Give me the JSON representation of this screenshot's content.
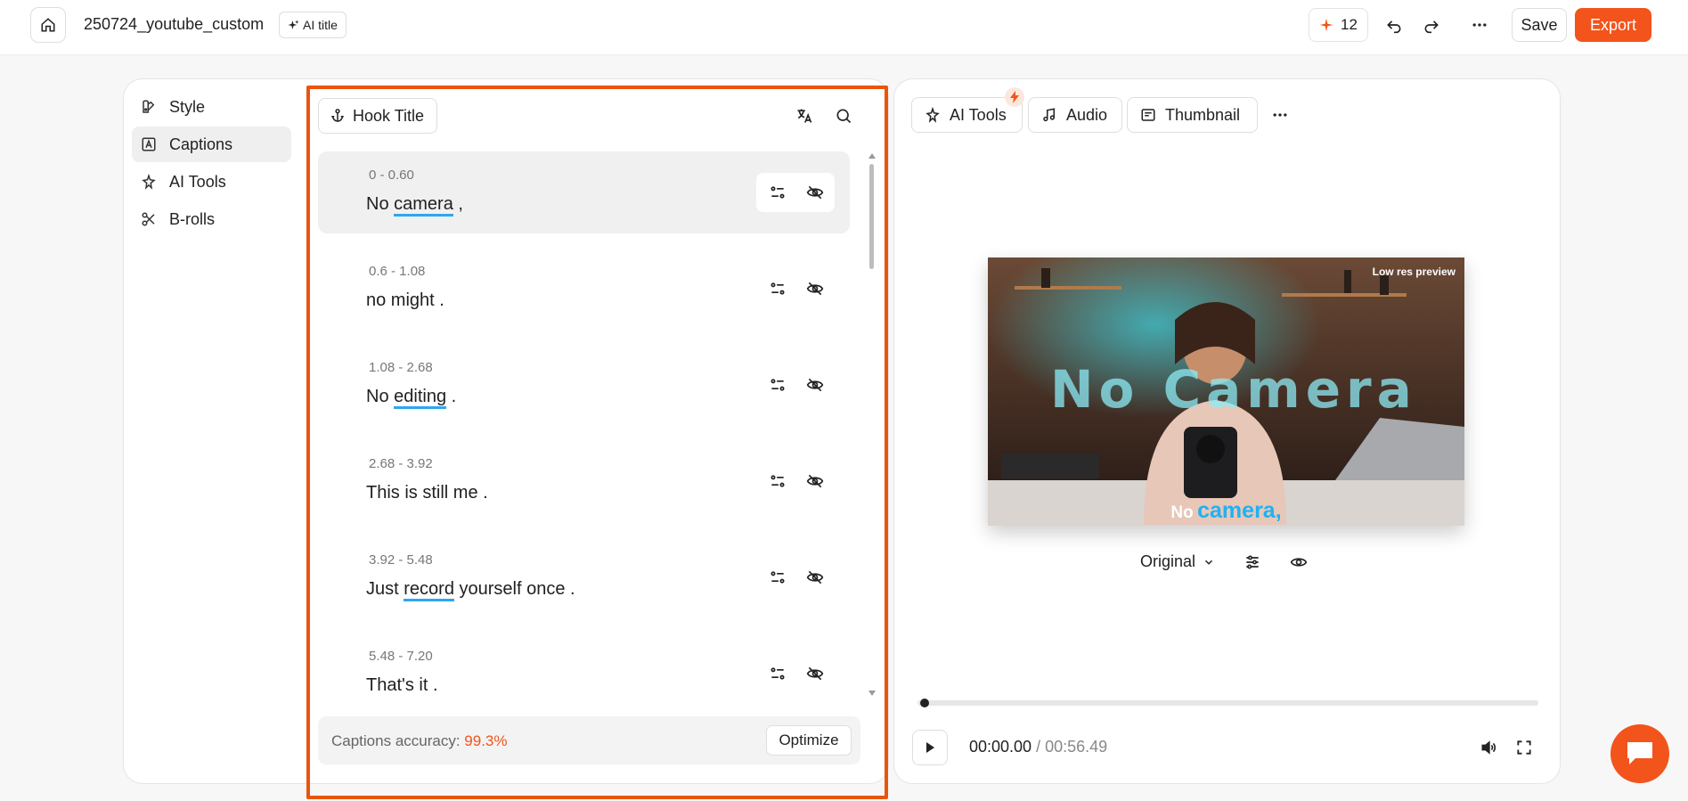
{
  "topbar": {
    "project_name": "250724_youtube_custom",
    "ai_title_label": "AI title",
    "credits_count": "12",
    "save_label": "Save",
    "export_label": "Export"
  },
  "sidebar": {
    "items": [
      {
        "label": "Style",
        "icon": "palette-icon"
      },
      {
        "label": "Captions",
        "icon": "caption-icon",
        "active": true
      },
      {
        "label": "AI Tools",
        "icon": "magic-wand-icon"
      },
      {
        "label": "B-rolls",
        "icon": "scissors-icon"
      }
    ]
  },
  "captions": {
    "hook_title_label": "Hook Title",
    "rows": [
      {
        "time": "0 - 0.60",
        "pre": "No ",
        "highlight": "camera",
        "post": " ,",
        "selected": true
      },
      {
        "time": "0.6 - 1.08",
        "pre": "no might .",
        "highlight": "",
        "post": ""
      },
      {
        "time": "1.08 - 2.68",
        "pre": "No ",
        "highlight": "editing",
        "post": " ."
      },
      {
        "time": "2.68 - 3.92",
        "pre": "This is still me .",
        "highlight": "",
        "post": ""
      },
      {
        "time": "3.92 - 5.48",
        "pre": "Just ",
        "highlight": "record",
        "post": " yourself once ."
      },
      {
        "time": "5.48 - 7.20",
        "pre": "That's it .",
        "highlight": "",
        "post": ""
      }
    ],
    "accuracy_label": "Captions accuracy: ",
    "accuracy_value": "99.3%",
    "optimize_label": "Optimize"
  },
  "player": {
    "tools": [
      {
        "label": "AI Tools",
        "icon": "magic-wand-icon"
      },
      {
        "label": "Audio",
        "icon": "music-note-icon"
      },
      {
        "label": "Thumbnail",
        "icon": "thumbnail-icon"
      }
    ],
    "low_res_label": "Low res preview",
    "overlay_title": "No Camera",
    "burned_caption_a": "No",
    "burned_caption_b": "camera,",
    "quality_label": "Original",
    "current_time": "00:00.00",
    "separator": "/",
    "total_time": "00:56.49",
    "progress": 0
  },
  "colors": {
    "accent": "#f2541b",
    "highlight": "#2da7f0",
    "panel_border": "#e8560e"
  }
}
